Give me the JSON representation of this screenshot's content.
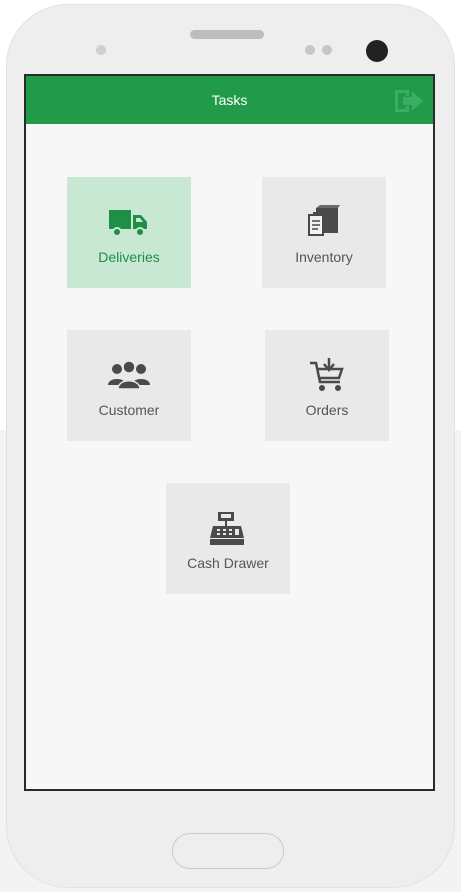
{
  "app": {
    "title": "Tasks",
    "accent_color": "#219a4a",
    "header_icon": "exit-icon"
  },
  "tiles": [
    {
      "label": "Deliveries",
      "icon": "truck-icon",
      "selected": true
    },
    {
      "label": "Inventory",
      "icon": "inventory-icon",
      "selected": false
    },
    {
      "label": "Customer",
      "icon": "customers-icon",
      "selected": false
    },
    {
      "label": "Orders",
      "icon": "cart-icon",
      "selected": false
    },
    {
      "label": "Cash Drawer",
      "icon": "cash-register-icon",
      "selected": false
    }
  ]
}
